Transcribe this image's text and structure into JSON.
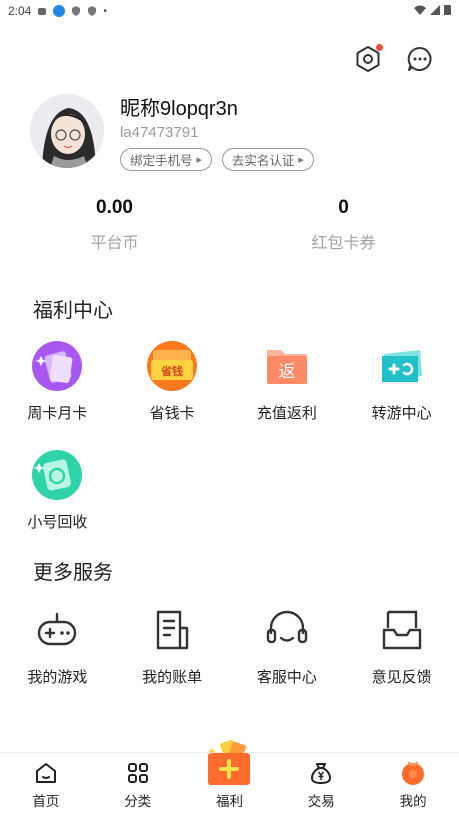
{
  "status_bar": {
    "time": "2:04"
  },
  "header": {
    "settings_icon": "settings-hex-icon",
    "message_icon": "message-icon",
    "settings_has_badge": true
  },
  "profile": {
    "nickname": "昵称9lopqr3n",
    "user_id": "la47473791",
    "bind_phone_label": "绑定手机号",
    "verify_label": "去实名认证"
  },
  "stats": [
    {
      "value": "0.00",
      "label": "平台币"
    },
    {
      "value": "0",
      "label": "红包卡券"
    }
  ],
  "welfare": {
    "title": "福利中心",
    "items": [
      {
        "label": "周卡月卡",
        "icon": "weekly-monthly-card-icon"
      },
      {
        "label": "省钱卡",
        "icon": "money-saving-card-icon",
        "badge_text": "省钱"
      },
      {
        "label": "充值返利",
        "icon": "recharge-rebate-icon",
        "badge_text": "返"
      },
      {
        "label": "转游中心",
        "icon": "game-transfer-icon"
      },
      {
        "label": "小号回收",
        "icon": "account-recycle-icon"
      }
    ]
  },
  "services": {
    "title": "更多服务",
    "items": [
      {
        "label": "我的游戏",
        "icon": "gamepad-icon"
      },
      {
        "label": "我的账单",
        "icon": "bill-icon"
      },
      {
        "label": "客服中心",
        "icon": "headset-icon"
      },
      {
        "label": "意见反馈",
        "icon": "feedback-icon"
      }
    ]
  },
  "bottom_nav": [
    {
      "label": "首页",
      "icon": "home-icon"
    },
    {
      "label": "分类",
      "icon": "category-icon"
    },
    {
      "label": "福利",
      "icon": "welfare-gift-icon"
    },
    {
      "label": "交易",
      "icon": "trade-bag-icon"
    },
    {
      "label": "我的",
      "icon": "mine-icon"
    }
  ],
  "colors": {
    "accent_red": "#f04a3e",
    "orange": "#ff6b2c",
    "purple": "#9b4df0",
    "teal": "#2ec4b6"
  }
}
